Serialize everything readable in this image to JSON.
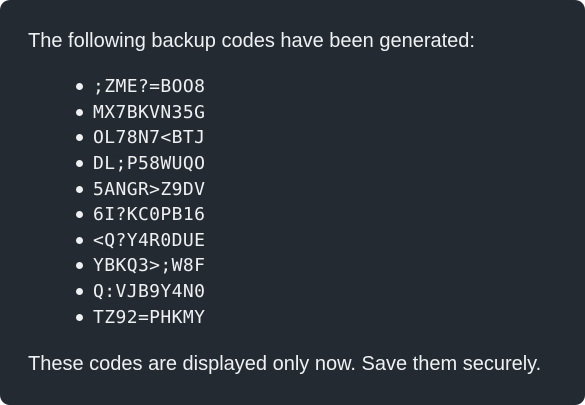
{
  "panel": {
    "intro_text": "The following backup codes have been generated:",
    "codes": [
      ";ZME?=BOO8",
      "MX7BKVN35G",
      "OL78N7<BTJ",
      "DL;P58WUQO",
      "5ANGR>Z9DV",
      "6I?KC0PB16",
      "<Q?Y4R0DUE",
      "YBKQ3>;W8F",
      "Q:VJB9Y4N0",
      "TZ92=PHKMY"
    ],
    "note_text": "These codes are displayed only now. Save them securely."
  },
  "colors": {
    "background": "#232a32",
    "text": "#eef0f2"
  }
}
